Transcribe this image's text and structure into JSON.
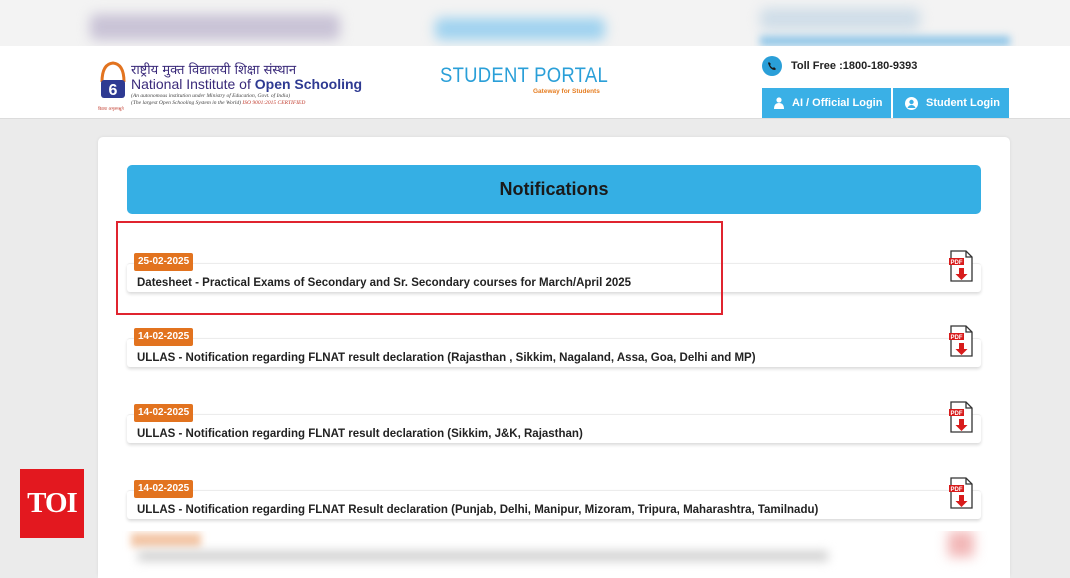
{
  "header": {
    "logo": {
      "hindi": "राष्ट्रीय मुक्त विद्यालयी शिक्षा संस्थान",
      "english_prefix": "National Institute of ",
      "english_bold": "Open Schooling",
      "sub1": "(An autonomous institution under Ministry of Education, Govt. of India)",
      "sub2": "(The largest Open Schooling System in the World)",
      "sub2_iso": "ISO 9001:2015 CERTIFIED",
      "motto": "विद्यया अमृतमश्नुते"
    },
    "portal": {
      "title": "STUDENT PORTAL",
      "subtitle": "Gateway for Students"
    },
    "tollfree": "Toll Free :1800-180-9393",
    "buttons": {
      "official_login": "AI / Official Login",
      "student_login": "Student Login"
    }
  },
  "notifications": {
    "title": "Notifications",
    "items": [
      {
        "date": "25-02-2025",
        "text": "Datesheet - Practical Exams of Secondary and Sr. Secondary courses for March/April 2025"
      },
      {
        "date": "14-02-2025",
        "text": "ULLAS - Notification regarding FLNAT result declaration (Rajasthan , Sikkim, Nagaland, Assa, Goa, Delhi and MP)"
      },
      {
        "date": "14-02-2025",
        "text": "ULLAS - Notification regarding FLNAT result declaration (Sikkim, J&K, Rajasthan)"
      },
      {
        "date": "14-02-2025",
        "text": "ULLAS - Notification regarding FLNAT Result declaration (Punjab, Delhi, Manipur, Mizoram, Tripura, Maharashtra, Tamilnadu)"
      }
    ],
    "pdf_icon": "pdf-download-icon"
  },
  "watermark": {
    "text": "TOI"
  },
  "colors": {
    "accent_blue": "#35afe4",
    "date_badge": "#e2731f",
    "highlight_border": "#e0242f",
    "toi_red": "#e3181f"
  }
}
